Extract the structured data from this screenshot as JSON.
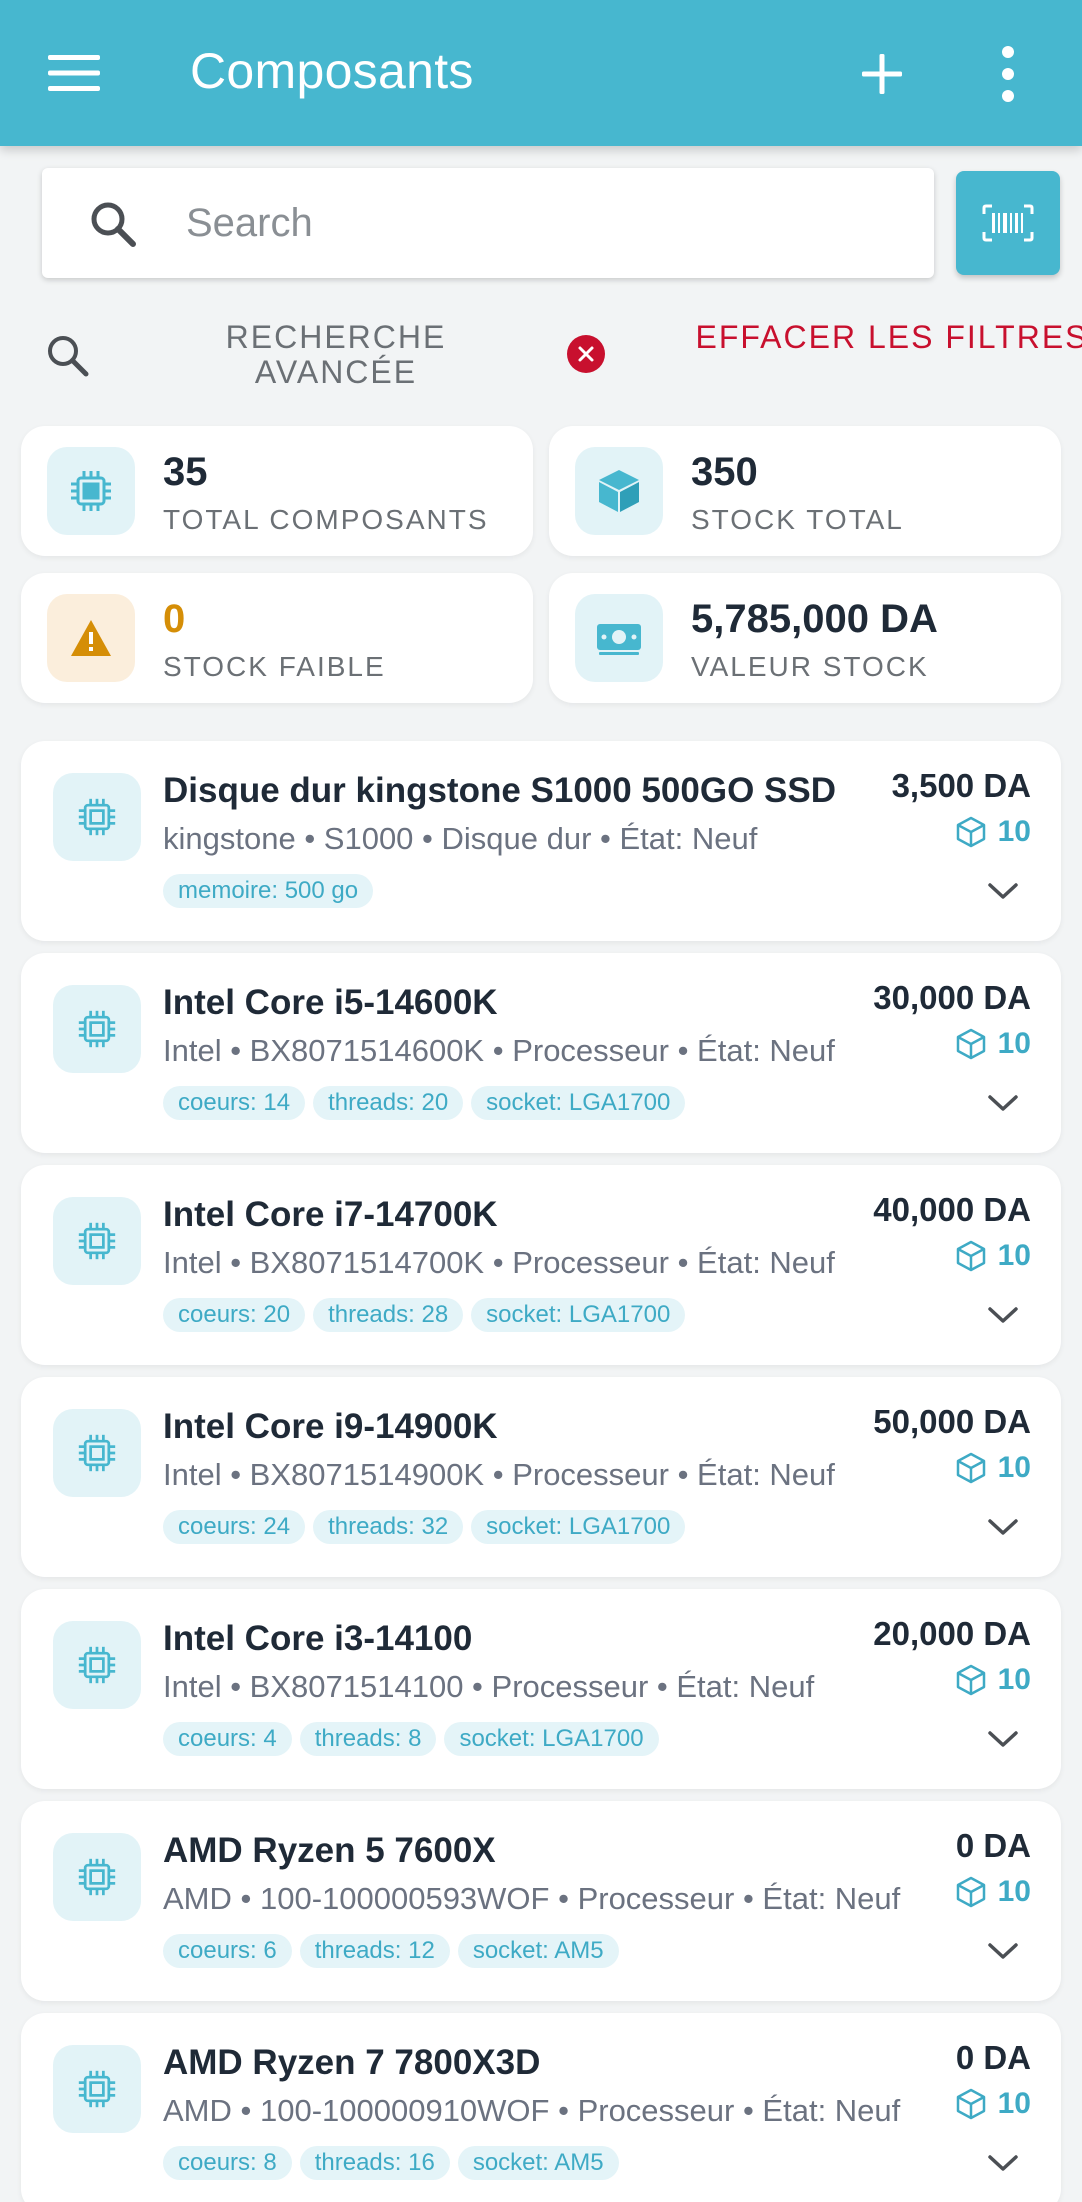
{
  "appbar": {
    "title": "Composants"
  },
  "search": {
    "placeholder": "Search",
    "value": ""
  },
  "filters": {
    "advanced_search_label": "RECHERCHE AVANCÉE",
    "clear_filters_label": "EFFACER LES FILTRES"
  },
  "stats": [
    {
      "value": "35",
      "label": "TOTAL COMPOSANTS",
      "icon": "cpu-chip-icon"
    },
    {
      "value": "350",
      "label": "STOCK TOTAL",
      "icon": "box-icon"
    },
    {
      "value": "0",
      "label": "STOCK FAIBLE",
      "icon": "warning-icon"
    },
    {
      "value": "5,785,000 DA",
      "label": "VALEUR STOCK",
      "icon": "cash-icon"
    }
  ],
  "colors": {
    "primary": "#47b7cf",
    "danger": "#c8102e",
    "warning": "#d58e07",
    "tag_text": "#3eaac5",
    "tag_bg": "#e4f4f8"
  },
  "products": [
    {
      "name": "Disque dur kingstone S1000 500GO SSD",
      "meta": "kingstone • S1000 • Disque dur • État: Neuf",
      "price": "3,500 DA",
      "stock": "10",
      "tags": [
        "memoire: 500 go"
      ]
    },
    {
      "name": "Intel Core i5-14600K",
      "meta": "Intel • BX8071514600K • Processeur • État: Neuf",
      "price": "30,000 DA",
      "stock": "10",
      "tags": [
        "coeurs: 14",
        "threads: 20",
        "socket: LGA1700"
      ]
    },
    {
      "name": "Intel Core i7-14700K",
      "meta": "Intel • BX8071514700K • Processeur • État: Neuf",
      "price": "40,000 DA",
      "stock": "10",
      "tags": [
        "coeurs: 20",
        "threads: 28",
        "socket: LGA1700"
      ]
    },
    {
      "name": "Intel Core i9-14900K",
      "meta": "Intel • BX8071514900K • Processeur • État: Neuf",
      "price": "50,000 DA",
      "stock": "10",
      "tags": [
        "coeurs: 24",
        "threads: 32",
        "socket: LGA1700"
      ]
    },
    {
      "name": "Intel Core i3-14100",
      "meta": "Intel • BX8071514100 • Processeur • État: Neuf",
      "price": "20,000 DA",
      "stock": "10",
      "tags": [
        "coeurs: 4",
        "threads: 8",
        "socket: LGA1700"
      ]
    },
    {
      "name": "AMD Ryzen 5 7600X",
      "meta": "AMD • 100-100000593WOF • Processeur • État: Neuf",
      "price": "0 DA",
      "stock": "10",
      "tags": [
        "coeurs: 6",
        "threads: 12",
        "socket: AM5"
      ]
    },
    {
      "name": "AMD Ryzen 7 7800X3D",
      "meta": "AMD • 100-100000910WOF • Processeur • État: Neuf",
      "price": "0 DA",
      "stock": "10",
      "tags": [
        "coeurs: 8",
        "threads: 16",
        "socket: AM5"
      ]
    }
  ]
}
